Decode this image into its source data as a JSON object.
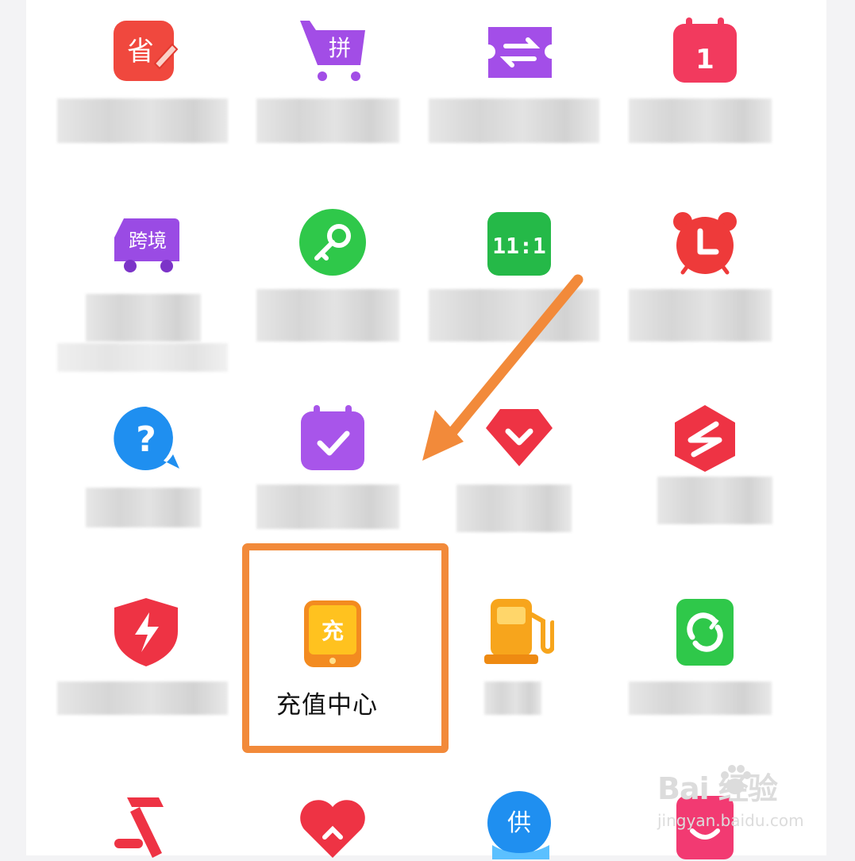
{
  "grid": {
    "highlighted_item": {
      "label": "充值中心",
      "icon": "recharge-phone-icon",
      "glyph": "充"
    },
    "icons": {
      "savings": {
        "name": "savings-icon",
        "glyph": "省"
      },
      "group_buy": {
        "name": "group-buy-cart-icon",
        "glyph": "拼"
      },
      "exchange": {
        "name": "exchange-ticket-icon"
      },
      "calendar_day": {
        "name": "calendar-day-icon",
        "glyph": "1"
      },
      "cross_border": {
        "name": "cross-border-truck-icon",
        "glyph": "跨境"
      },
      "key": {
        "name": "key-icon"
      },
      "counter": {
        "name": "counter-display-icon",
        "glyph": "11:1"
      },
      "alarm": {
        "name": "alarm-clock-icon"
      },
      "help": {
        "name": "help-question-icon",
        "glyph": "?"
      },
      "checkin": {
        "name": "calendar-check-icon"
      },
      "gem": {
        "name": "gem-down-icon"
      },
      "s_logo": {
        "name": "s-hexagon-icon"
      },
      "shield": {
        "name": "lightning-shield-icon"
      },
      "fuel": {
        "name": "fuel-pump-icon"
      },
      "refresh": {
        "name": "refresh-cycle-icon"
      },
      "hammer": {
        "name": "hammer-icon"
      },
      "heart": {
        "name": "heart-icon"
      },
      "supply": {
        "name": "supply-globe-icon",
        "glyph": "供"
      },
      "smile": {
        "name": "smile-box-icon"
      }
    }
  },
  "watermark": {
    "brand": "Bai  经验",
    "url": "jingyan.baidu.com"
  },
  "colors": {
    "highlight": "#f28a3a",
    "arrow": "#f28a3a"
  }
}
